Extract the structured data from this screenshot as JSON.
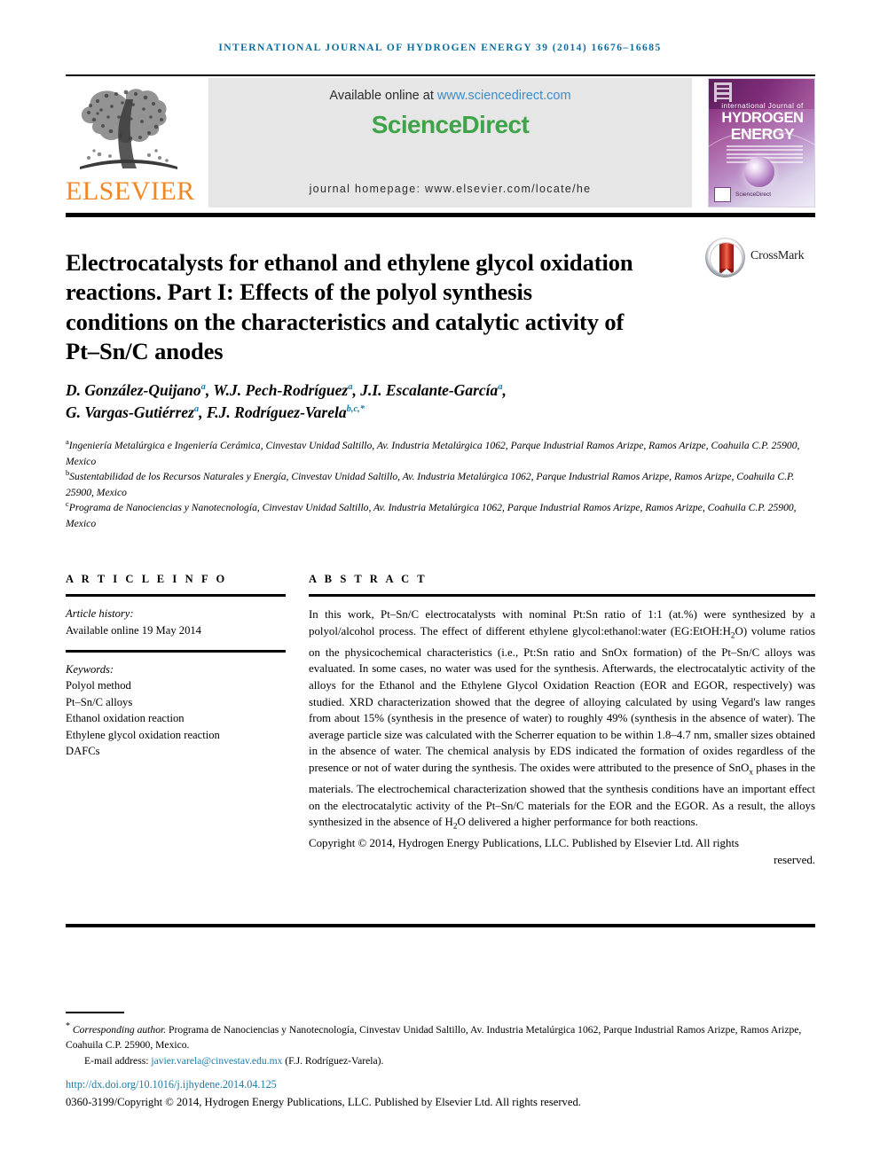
{
  "running_head": "INTERNATIONAL JOURNAL OF HYDROGEN ENERGY 39 (2014) 16676–16685",
  "header": {
    "publisher_logo_text": "ELSEVIER",
    "available_prefix": "Available online at ",
    "available_url": "www.sciencedirect.com",
    "sciencedirect_logo": "ScienceDirect",
    "journal_homepage": "journal homepage: www.elsevier.com/locate/he",
    "cover": {
      "small_title": "international Journal of",
      "big_line1": "HYDROGEN",
      "big_line2": "ENERGY",
      "footer_text": "ScienceDirect"
    }
  },
  "crossmark": {
    "label": "CrossMark"
  },
  "article": {
    "title": "Electrocatalysts for ethanol and ethylene glycol oxidation reactions. Part I: Effects of the polyol synthesis conditions on the characteristics and catalytic activity of Pt–Sn/C anodes",
    "authors_line1": "D. González-Quijano",
    "authors": [
      {
        "name": "D. González-Quijano",
        "sup": "a",
        "sep": ", "
      },
      {
        "name": "W.J. Pech-Rodríguez",
        "sup": "a",
        "sep": ", "
      },
      {
        "name": "J.I. Escalante-García",
        "sup": "a",
        "sep": ","
      },
      {
        "name": "G. Vargas-Gutiérrez",
        "sup": "a",
        "sep": ", "
      },
      {
        "name": "F.J. Rodríguez-Varela",
        "sup": "b,c,*",
        "sep": ""
      }
    ],
    "affiliations": [
      {
        "marker": "a",
        "text": "Ingeniería Metalúrgica e Ingeniería Cerámica, Cinvestav Unidad Saltillo, Av. Industria Metalúrgica 1062, Parque Industrial Ramos Arizpe, Ramos Arizpe, Coahuila C.P. 25900, Mexico"
      },
      {
        "marker": "b",
        "text": "Sustentabilidad de los Recursos Naturales y Energía, Cinvestav Unidad Saltillo, Av. Industria Metalúrgica 1062, Parque Industrial Ramos Arizpe, Ramos Arizpe, Coahuila C.P. 25900, Mexico"
      },
      {
        "marker": "c",
        "text": "Programa de Nanociencias y Nanotecnología, Cinvestav Unidad Saltillo, Av. Industria Metalúrgica 1062, Parque Industrial Ramos Arizpe, Ramos Arizpe, Coahuila C.P. 25900, Mexico"
      }
    ]
  },
  "article_info": {
    "heading": "A R T I C L E   I N F O",
    "history_label": "Article history:",
    "history_value": "Available online 19 May 2014",
    "keywords_label": "Keywords:",
    "keywords": [
      "Polyol method",
      "Pt–Sn/C alloys",
      "Ethanol oxidation reaction",
      "Ethylene glycol oxidation reaction",
      "DAFCs"
    ]
  },
  "abstract": {
    "heading": "A B S T R A C T",
    "paragraph": "In this work, Pt–Sn/C electrocatalysts with nominal Pt:Sn ratio of 1:1 (at.%) were synthesized by a polyol/alcohol process. The effect of different ethylene glycol:ethanol:water (EG:EtOH:H2O) volume ratios on the physicochemical characteristics (i.e., Pt:Sn ratio and SnOx formation) of the Pt–Sn/C alloys was evaluated. In some cases, no water was used for the synthesis. Afterwards, the electrocatalytic activity of the alloys for the Ethanol and the Ethylene Glycol Oxidation Reaction (EOR and EGOR, respectively) was studied. XRD characterization showed that the degree of alloying calculated by using Vegard's law ranges from about 15% (synthesis in the presence of water) to roughly 49% (synthesis in the absence of water). The average particle size was calculated with the Scherrer equation to be within 1.8–4.7 nm, smaller sizes obtained in the absence of water. The chemical analysis by EDS indicated the formation of oxides regardless of the presence or not of water during the synthesis. The oxides were attributed to the presence of SnOx phases in the materials. The electrochemical characterization showed that the synthesis conditions have an important effect on the electrocatalytic activity of the Pt–Sn/C materials for the EOR and the EGOR. As a result, the alloys synthesized in the absence of H2O delivered a higher performance for both reactions.",
    "copyright_main": "Copyright © 2014, Hydrogen Energy Publications, LLC. Published by Elsevier Ltd. All rights",
    "copyright_tail": "reserved."
  },
  "footnotes": {
    "corresponding_label": "Corresponding author.",
    "corresponding_text": " Programa de Nanociencias y Nanotecnología, Cinvestav Unidad Saltillo, Av. Industria Metalúrgica 1062, Parque Industrial Ramos Arizpe, Ramos Arizpe, Coahuila C.P. 25900, Mexico.",
    "email_label": "E-mail address:",
    "email_address": "javier.varela@cinvestav.edu.mx",
    "email_owner": "(F.J. Rodríguez-Varela).",
    "doi": "http://dx.doi.org/10.1016/j.ijhydene.2014.04.125",
    "issn_line": "0360-3199/Copyright © 2014, Hydrogen Energy Publications, LLC. Published by Elsevier Ltd. All rights reserved."
  },
  "colors": {
    "running_head": "#0b6d9e",
    "link": "#1b7ba8",
    "elsevier_orange": "#f08723",
    "sciencedirect_green": "#3fa34a",
    "banner_grey": "#e6e6e6"
  }
}
